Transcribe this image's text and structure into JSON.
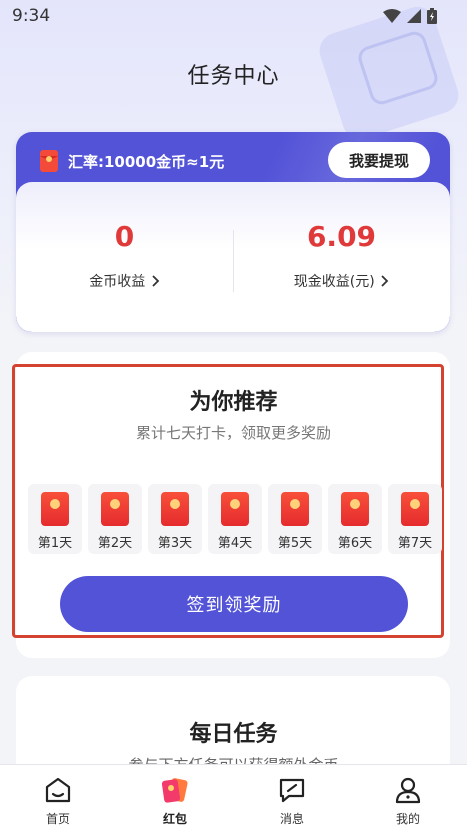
{
  "status_bar": {
    "time": "9:34"
  },
  "header": {
    "title": "任务中心"
  },
  "balance_card": {
    "rate_text": "汇率:10000金币≈1元",
    "withdraw_label": "我要提现",
    "coin_value": "0",
    "coin_label": "金币收益",
    "cash_value": "6.09",
    "cash_label": "现金收益(元)"
  },
  "recommend": {
    "title": "为你推荐",
    "subtitle": "累计七天打卡，领取更多奖励",
    "days": [
      "第1天",
      "第2天",
      "第3天",
      "第4天",
      "第5天",
      "第6天",
      "第7天"
    ],
    "button_label": "签到领奖励"
  },
  "daily_task": {
    "title": "每日任务",
    "subtitle": "参与下方任务可以获得额外金币"
  },
  "tabs": [
    {
      "label": "首页"
    },
    {
      "label": "红包"
    },
    {
      "label": "消息"
    },
    {
      "label": "我的"
    }
  ],
  "colors": {
    "accent": "#5353d8",
    "value_red": "#e0393a"
  }
}
